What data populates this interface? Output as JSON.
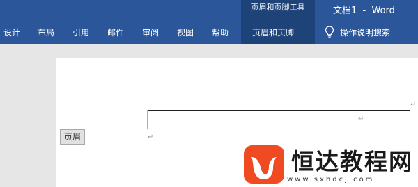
{
  "window": {
    "title": "文档1  -  Word"
  },
  "context_group": {
    "label": "页眉和页脚工具"
  },
  "tabs": [
    {
      "label": "设计"
    },
    {
      "label": "布局"
    },
    {
      "label": "引用"
    },
    {
      "label": "邮件"
    },
    {
      "label": "审阅"
    },
    {
      "label": "视图"
    },
    {
      "label": "帮助"
    },
    {
      "label": "页眉和页脚"
    }
  ],
  "tell_me": {
    "label": "操作说明搜索",
    "icon": "lightbulb-icon"
  },
  "document": {
    "header_label": "页眉",
    "return_mark": "↵"
  },
  "watermark": {
    "text": "恒达教程网",
    "url": "www.sxhdcj.com",
    "logo_color": "#f04a22"
  },
  "colors": {
    "ribbon": "#2b579a",
    "context_group": "#1d4378"
  }
}
